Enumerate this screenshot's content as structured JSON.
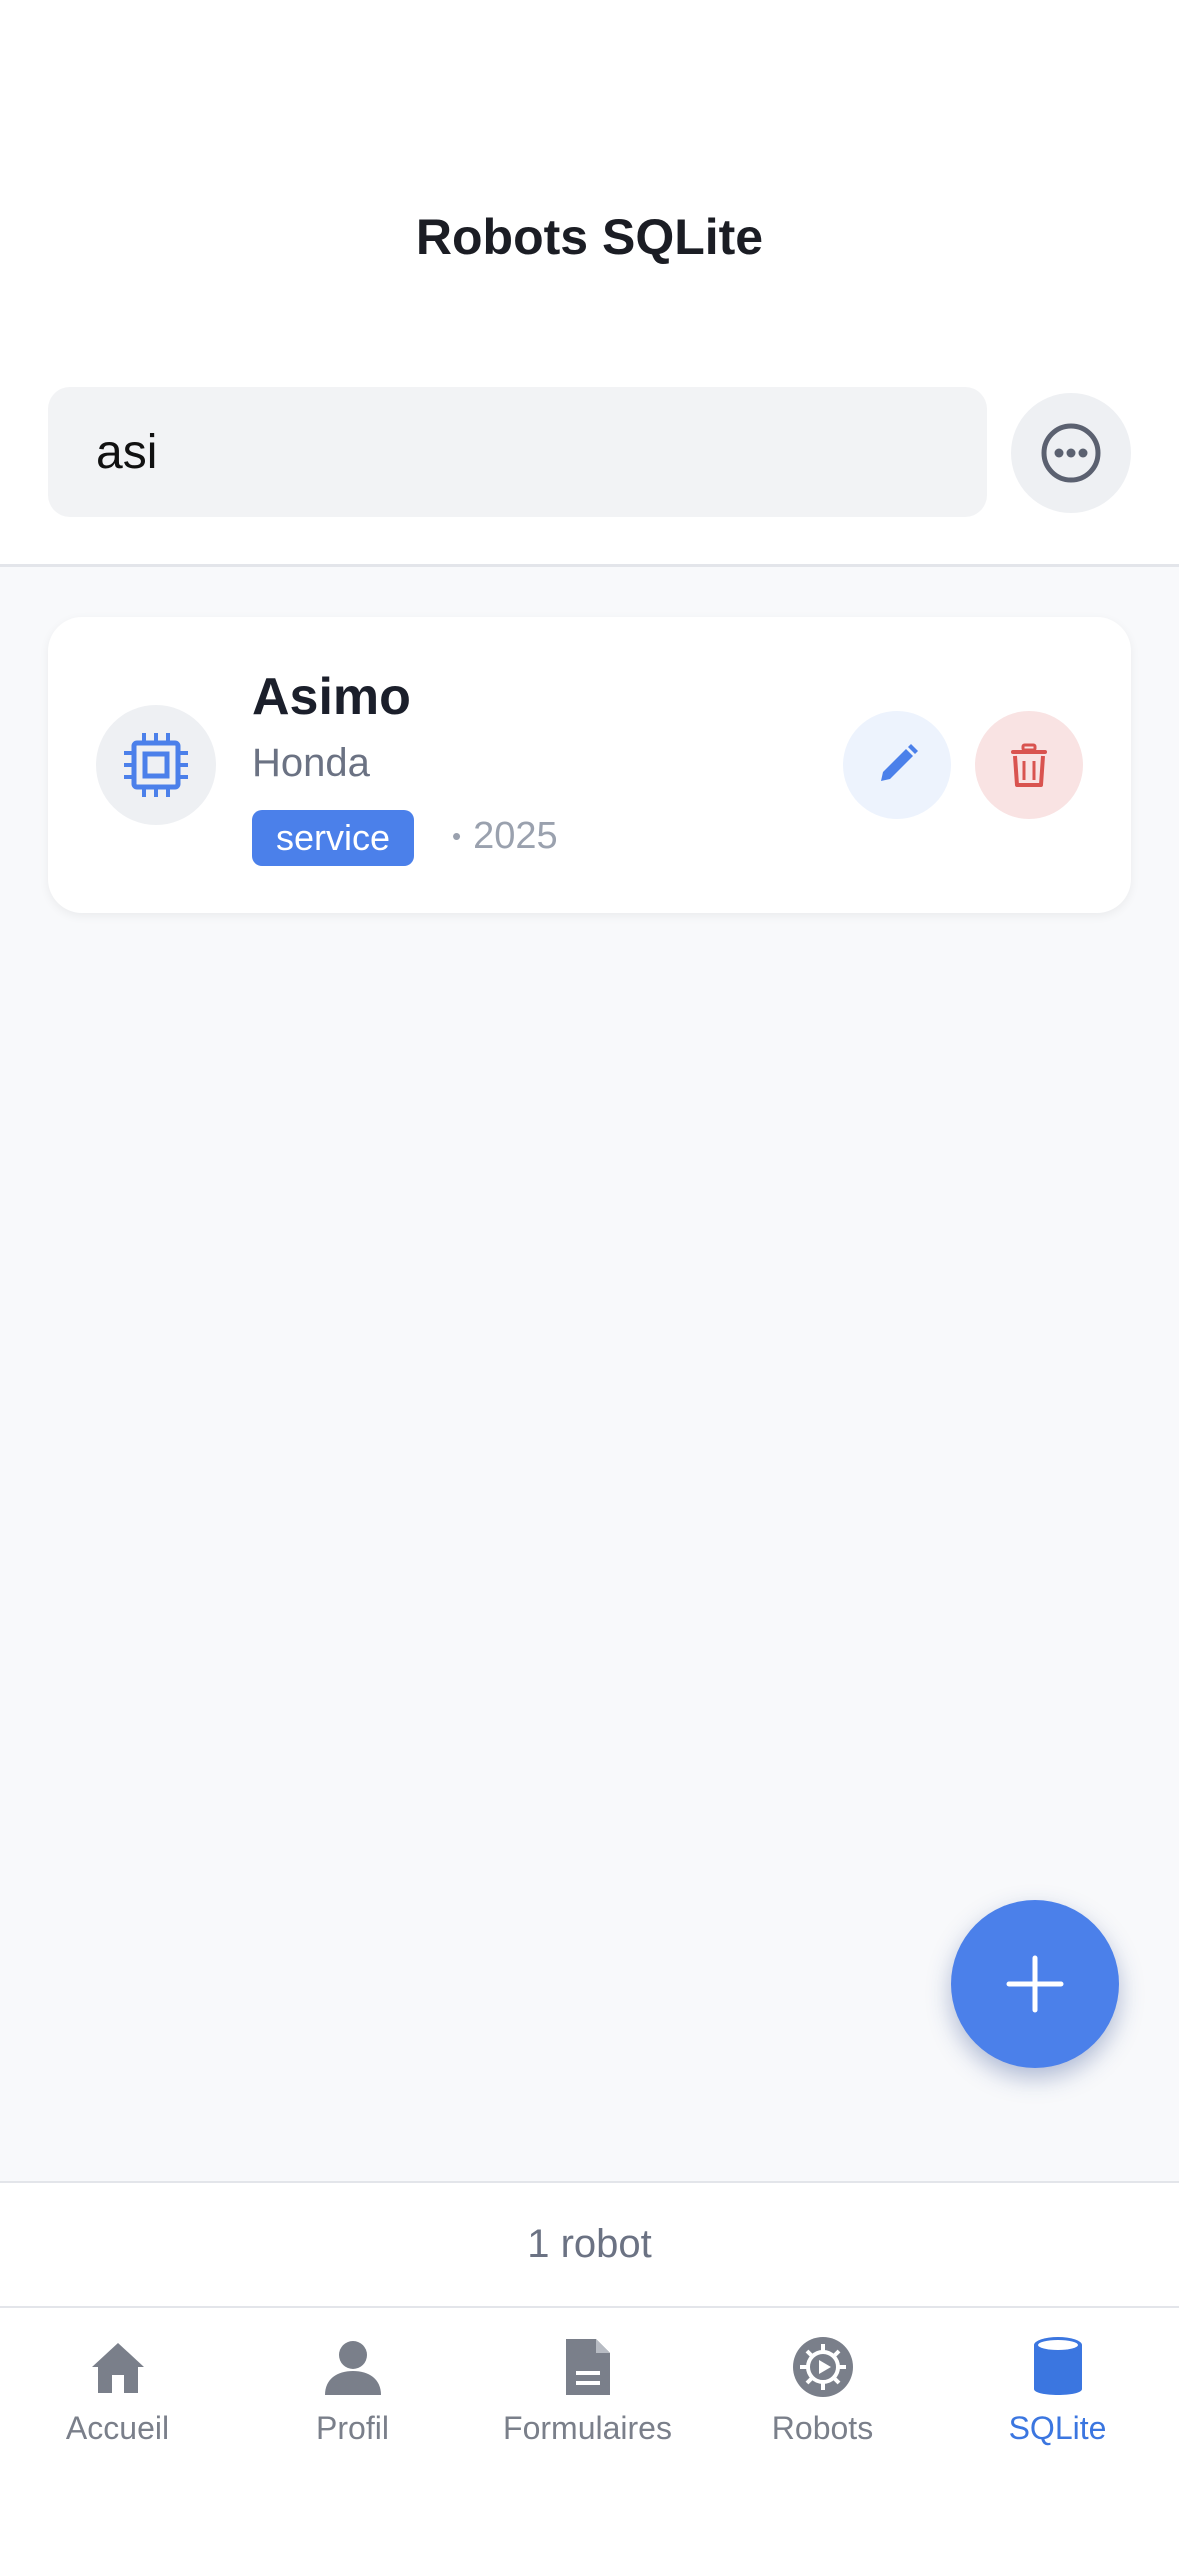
{
  "header": {
    "title": "Robots SQLite"
  },
  "search": {
    "value": "asi",
    "more_icon": "ellipsis-circle-icon"
  },
  "robots": [
    {
      "name": "Asimo",
      "maker": "Honda",
      "category": "service",
      "separator": "•",
      "year": "2025",
      "icon": "chip-icon"
    }
  ],
  "fab": {
    "icon": "plus-icon"
  },
  "footer": {
    "count_text": "1 robot"
  },
  "tabs": [
    {
      "label": "Accueil",
      "icon": "home-icon",
      "active": false
    },
    {
      "label": "Profil",
      "icon": "person-icon",
      "active": false
    },
    {
      "label": "Formulaires",
      "icon": "document-icon",
      "active": false
    },
    {
      "label": "Robots",
      "icon": "robot-gear-icon",
      "active": false
    },
    {
      "label": "SQLite",
      "icon": "database-icon",
      "active": true
    }
  ],
  "colors": {
    "accent": "#4b80ea",
    "danger": "#d9534f",
    "muted": "#7a7f8a"
  }
}
